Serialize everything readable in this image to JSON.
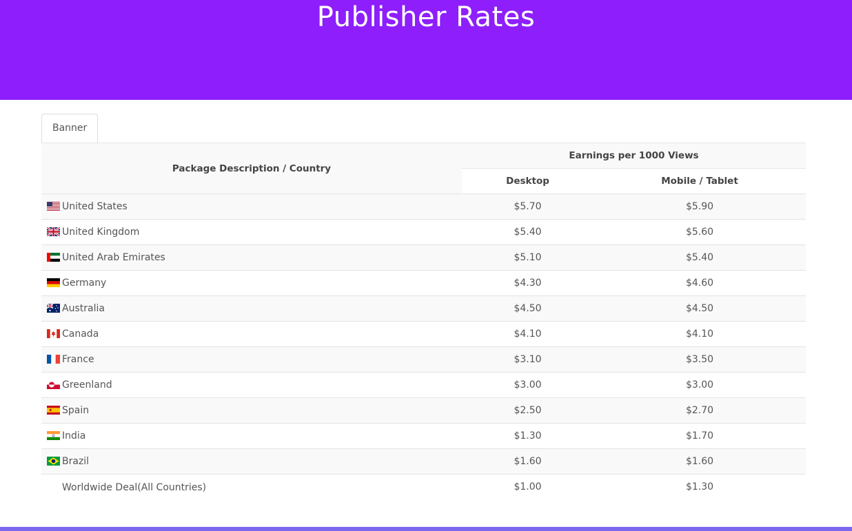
{
  "header": {
    "title": "Publisher Rates",
    "background": "#8e1ffc"
  },
  "tabs": [
    {
      "label": "Banner",
      "active": true
    }
  ],
  "table": {
    "col_package": "Package Description / Country",
    "col_group": "Earnings per 1000 Views",
    "col_desktop": "Desktop",
    "col_mobile": "Mobile / Tablet",
    "rows": [
      {
        "flag": "us-flag-icon",
        "country": "United States",
        "desktop": "$5.70",
        "mobile": "$5.90"
      },
      {
        "flag": "uk-flag-icon",
        "country": "United Kingdom",
        "desktop": "$5.40",
        "mobile": "$5.60"
      },
      {
        "flag": "uae-flag-icon",
        "country": "United Arab Emirates",
        "desktop": "$5.10",
        "mobile": "$5.40"
      },
      {
        "flag": "germany-flag-icon",
        "country": "Germany",
        "desktop": "$4.30",
        "mobile": "$4.60"
      },
      {
        "flag": "australia-flag-icon",
        "country": "Australia",
        "desktop": "$4.50",
        "mobile": "$4.50"
      },
      {
        "flag": "canada-flag-icon",
        "country": "Canada",
        "desktop": "$4.10",
        "mobile": "$4.10"
      },
      {
        "flag": "france-flag-icon",
        "country": "France",
        "desktop": "$3.10",
        "mobile": "$3.50"
      },
      {
        "flag": "greenland-flag-icon",
        "country": "Greenland",
        "desktop": "$3.00",
        "mobile": "$3.00"
      },
      {
        "flag": "spain-flag-icon",
        "country": "Spain",
        "desktop": "$2.50",
        "mobile": "$2.70"
      },
      {
        "flag": "india-flag-icon",
        "country": "India",
        "desktop": "$1.30",
        "mobile": "$1.70"
      },
      {
        "flag": "brazil-flag-icon",
        "country": "Brazil",
        "desktop": "$1.60",
        "mobile": "$1.60"
      },
      {
        "flag": "",
        "country": "Worldwide Deal(All Countries)",
        "desktop": "$1.00",
        "mobile": "$1.30"
      }
    ]
  }
}
